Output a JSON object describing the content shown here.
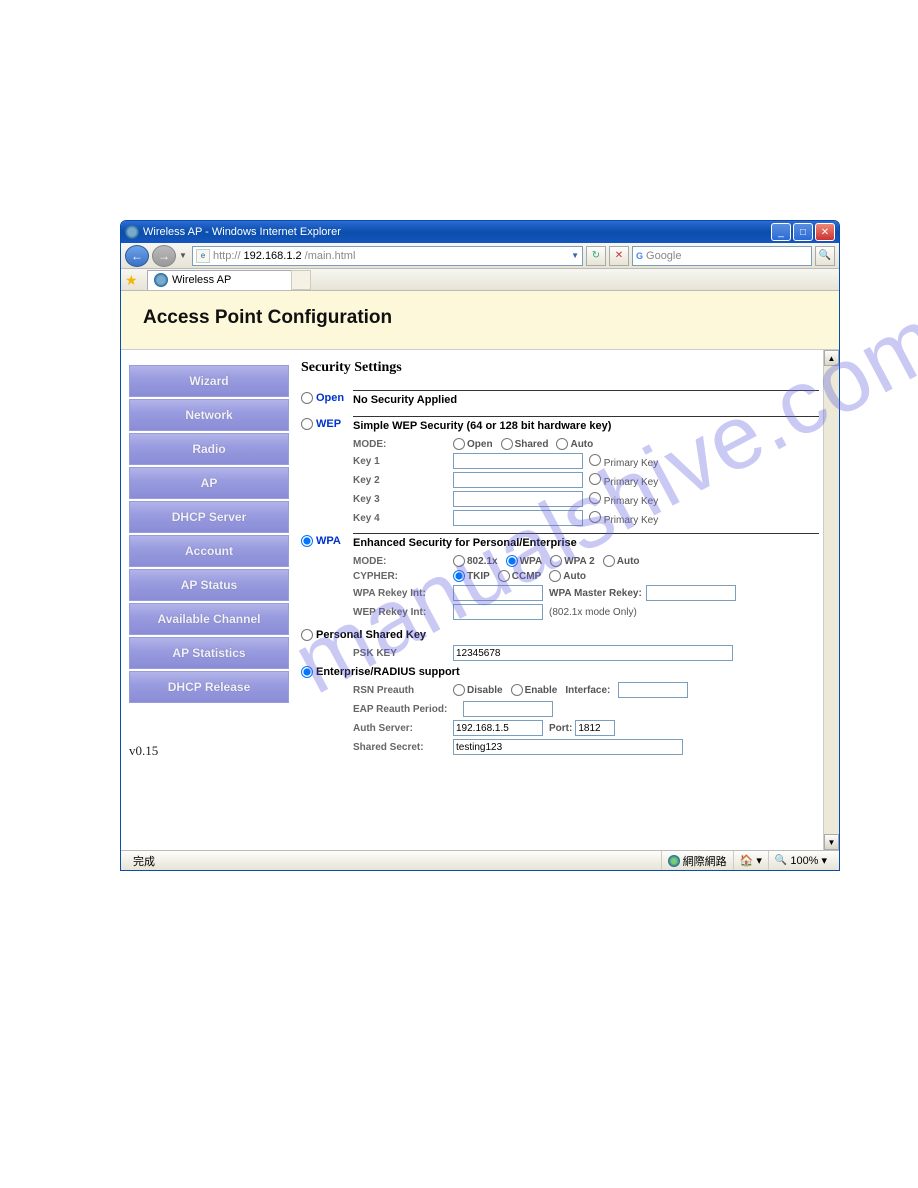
{
  "window": {
    "title": "Wireless AP - Windows Internet Explorer",
    "url_prefix": "http://",
    "url_host": "192.168.1.2",
    "url_path": "/main.html",
    "search_engine": "Google",
    "tab_title": "Wireless AP"
  },
  "header": {
    "title": "Access Point Configuration"
  },
  "sidebar": {
    "items": [
      "Wizard",
      "Network",
      "Radio",
      "AP",
      "DHCP Server",
      "Account",
      "AP Status",
      "Available Channel",
      "AP Statistics",
      "DHCP Release"
    ],
    "version": "v0.15"
  },
  "main": {
    "heading": "Security Settings",
    "open": {
      "label": "Open",
      "title": "No Security Applied"
    },
    "wep": {
      "label": "WEP",
      "title": "Simple WEP Security (64 or 128 bit hardware key)",
      "mode_label": "MODE:",
      "modes": [
        "Open",
        "Shared",
        "Auto"
      ],
      "keys": [
        "Key 1",
        "Key 2",
        "Key 3",
        "Key 4"
      ],
      "primary": "Primary Key"
    },
    "wpa": {
      "label": "WPA",
      "title": "Enhanced Security for Personal/Enterprise",
      "mode_label": "MODE:",
      "modes": [
        "802.1x",
        "WPA",
        "WPA 2",
        "Auto"
      ],
      "mode_selected": "WPA",
      "cypher_label": "CYPHER:",
      "cyphers": [
        "TKIP",
        "CCMP",
        "Auto"
      ],
      "cypher_selected": "TKIP",
      "rekey_label": "WPA Rekey Int:",
      "master_label": "WPA Master Rekey:",
      "wep_rekey_label": "WEP Rekey Int:",
      "wep_rekey_note": "(802.1x mode Only)"
    },
    "psk": {
      "label": "Personal Shared Key",
      "key_label": "PSK KEY",
      "key_value": "12345678"
    },
    "ent": {
      "label": "Enterprise/RADIUS support",
      "rsn_label": "RSN Preauth",
      "rsn_opts": [
        "Disable",
        "Enable"
      ],
      "interface_label": "Interface:",
      "eap_label": "EAP Reauth Period:",
      "auth_label": "Auth Server:",
      "auth_value": "192.168.1.5",
      "port_label": "Port:",
      "port_value": "1812",
      "secret_label": "Shared Secret:",
      "secret_value": "testing123"
    }
  },
  "statusbar": {
    "status": "完成",
    "zone": "網際網路",
    "zoom": "100%"
  },
  "watermark": "manualshive.com"
}
